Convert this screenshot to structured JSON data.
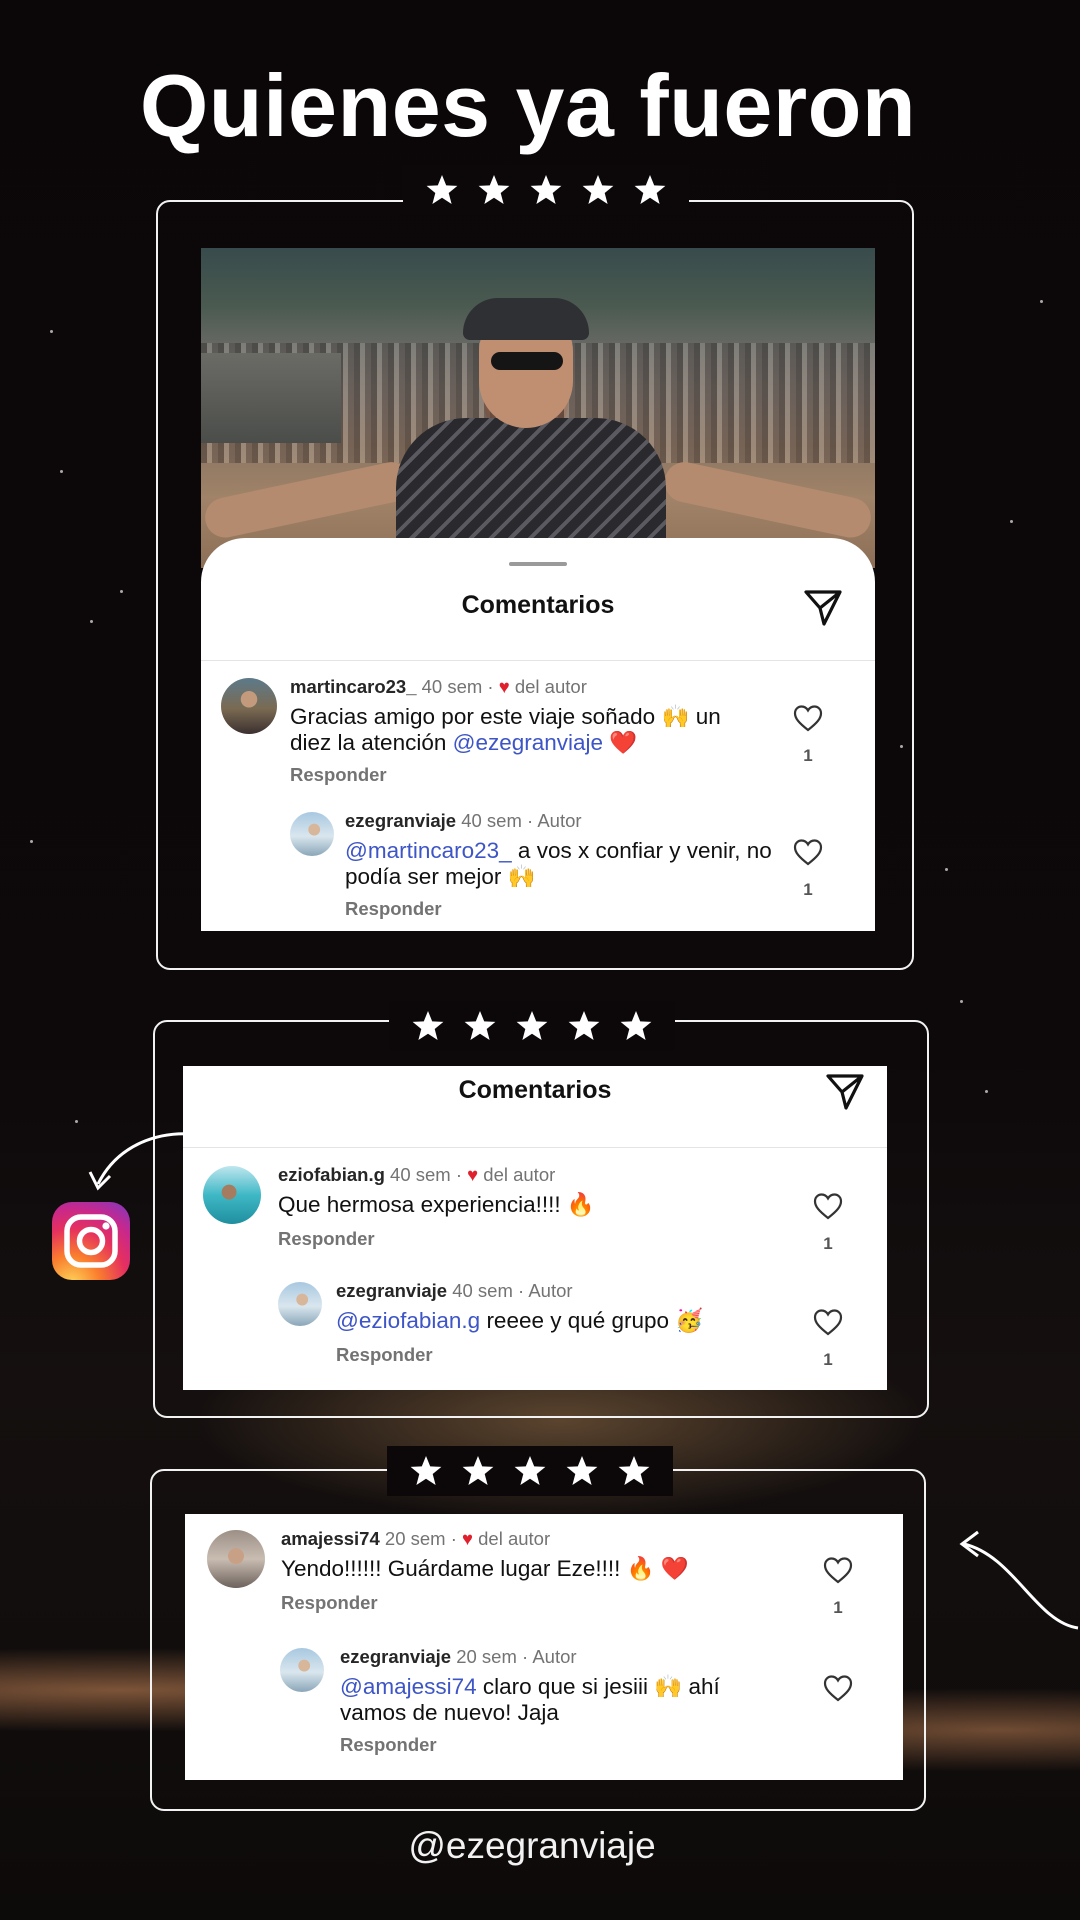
{
  "title": "Quienes ya fueron",
  "rating": {
    "stars": 5
  },
  "instagram": {
    "icon": "instagram-logo-icon"
  },
  "footer_handle": "@ezegranviaje",
  "cards": [
    {
      "sheet_title": "Comentarios",
      "comments": [
        {
          "user": "martincaro23_",
          "time": "40 sem",
          "tag_prefix": " · ",
          "heart": "♥",
          "tag": " del autor",
          "text_parts": [
            {
              "t": "Gracias amigo por este viaje soñado 🙌 un diez la atención ",
              "mention": false
            },
            {
              "t": "@ezegranviaje",
              "mention": true
            },
            {
              "t": " ❤️",
              "mention": false
            }
          ],
          "reply_label": "Responder",
          "likes": "1"
        },
        {
          "user": "ezegranviaje",
          "time": "40 sem",
          "tag_prefix": " · ",
          "heart": "",
          "tag": "Autor",
          "text_parts": [
            {
              "t": "@martincaro23_",
              "mention": true
            },
            {
              "t": " a vos x confiar y venir, no podía ser mejor 🙌",
              "mention": false
            }
          ],
          "reply_label": "Responder",
          "likes": "1"
        }
      ]
    },
    {
      "sheet_title": "Comentarios",
      "comments": [
        {
          "user": "eziofabian.g",
          "time": "40 sem",
          "tag_prefix": " · ",
          "heart": "♥",
          "tag": " del autor",
          "text_parts": [
            {
              "t": "Que hermosa experiencia!!!! 🔥",
              "mention": false
            }
          ],
          "reply_label": "Responder",
          "likes": "1"
        },
        {
          "user": "ezegranviaje",
          "time": "40 sem",
          "tag_prefix": " · ",
          "heart": "",
          "tag": "Autor",
          "text_parts": [
            {
              "t": "@eziofabian.g",
              "mention": true
            },
            {
              "t": " reeee y qué grupo 🥳",
              "mention": false
            }
          ],
          "reply_label": "Responder",
          "likes": "1"
        }
      ]
    },
    {
      "sheet_title": "",
      "comments": [
        {
          "user": "amajessi74",
          "time": "20 sem",
          "tag_prefix": " · ",
          "heart": "♥",
          "tag": " del autor",
          "text_parts": [
            {
              "t": "Yendo!!!!!! Guárdame lugar Eze!!!! 🔥 ❤️",
              "mention": false
            }
          ],
          "reply_label": "Responder",
          "likes": "1"
        },
        {
          "user": "ezegranviaje",
          "time": "20 sem",
          "tag_prefix": " · ",
          "heart": "",
          "tag": "Autor",
          "text_parts": [
            {
              "t": "@amajessi74",
              "mention": true
            },
            {
              "t": " claro que si jesiii 🙌 ahí vamos de nuevo! Jaja",
              "mention": false
            }
          ],
          "reply_label": "Responder",
          "likes": ""
        }
      ]
    }
  ]
}
